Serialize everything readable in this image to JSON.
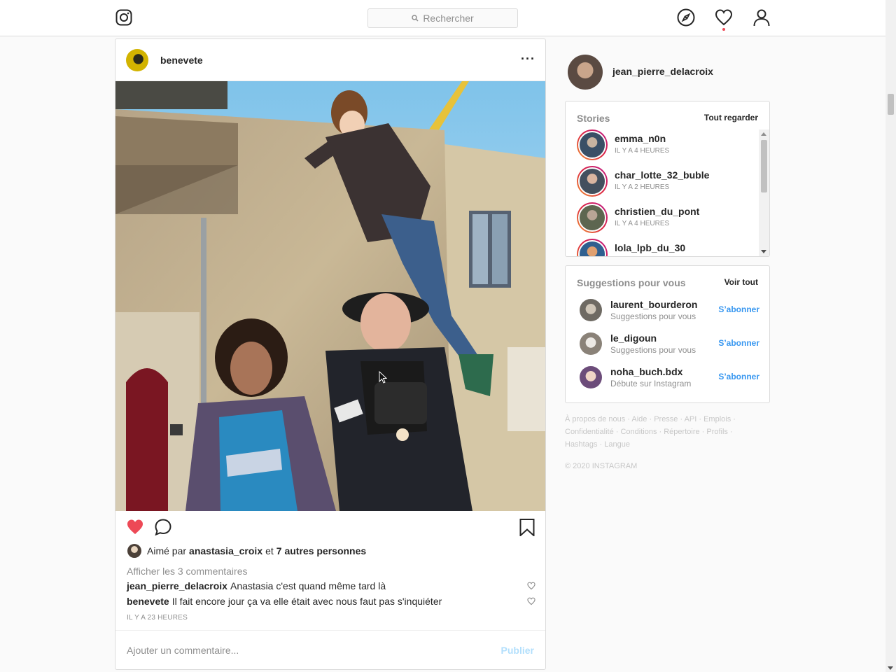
{
  "header": {
    "search_placeholder": "Rechercher",
    "icons": [
      "instagram-logo-icon",
      "search-icon",
      "explore-compass-icon",
      "activity-heart-icon",
      "profile-icon"
    ]
  },
  "post": {
    "username": "benevete",
    "more_icon": "···",
    "image_description_icon": "photo",
    "liked": true,
    "likes": {
      "prefix": "Aimé par",
      "user": "anastasia_croix",
      "conj": "et",
      "others": "7 autres personnes"
    },
    "view_comments": "Afficher les 3 commentaires",
    "comments": [
      {
        "user": "jean_pierre_delacroix",
        "text": "Anastasia c'est quand même tard là"
      },
      {
        "user": "benevete",
        "text": "Il fait encore jour ça va elle était avec nous faut pas s'inquiéter"
      }
    ],
    "time": "IL Y A 23 HEURES",
    "comment_placeholder": "Ajouter un commentaire...",
    "publish_label": "Publier"
  },
  "sidebar": {
    "me": {
      "username": "jean_pierre_delacroix"
    },
    "stories": {
      "title": "Stories",
      "see_all": "Tout regarder",
      "items": [
        {
          "user": "emma_n0n",
          "time": "IL Y A 4 HEURES"
        },
        {
          "user": "char_lotte_32_buble",
          "time": "IL Y A 2 HEURES"
        },
        {
          "user": "christien_du_pont",
          "time": "IL Y A 4 HEURES"
        },
        {
          "user": "lola_lpb_du_30",
          "time": ""
        }
      ]
    },
    "suggestions": {
      "title": "Suggestions pour vous",
      "see_all": "Voir tout",
      "items": [
        {
          "user": "laurent_bourderon",
          "sub": "Suggestions pour vous",
          "action": "S’abonner"
        },
        {
          "user": "le_digoun",
          "sub": "Suggestions pour vous",
          "action": "S’abonner"
        },
        {
          "user": "noha_buch.bdx",
          "sub": "Débute sur Instagram",
          "action": "S’abonner"
        }
      ]
    },
    "footer": {
      "line1": "À propos de nous · Aide · Presse · API · Emplois ·",
      "line2": "Confidentialité · Conditions · Répertoire · Profils ·",
      "line3": "Hashtags · Langue",
      "copyright": "© 2020 INSTAGRAM"
    }
  },
  "colors": {
    "like_red": "#ed4956",
    "link_blue": "#3897f0",
    "publish_disabled": "#b2dffc",
    "border": "#dbdbdb"
  }
}
